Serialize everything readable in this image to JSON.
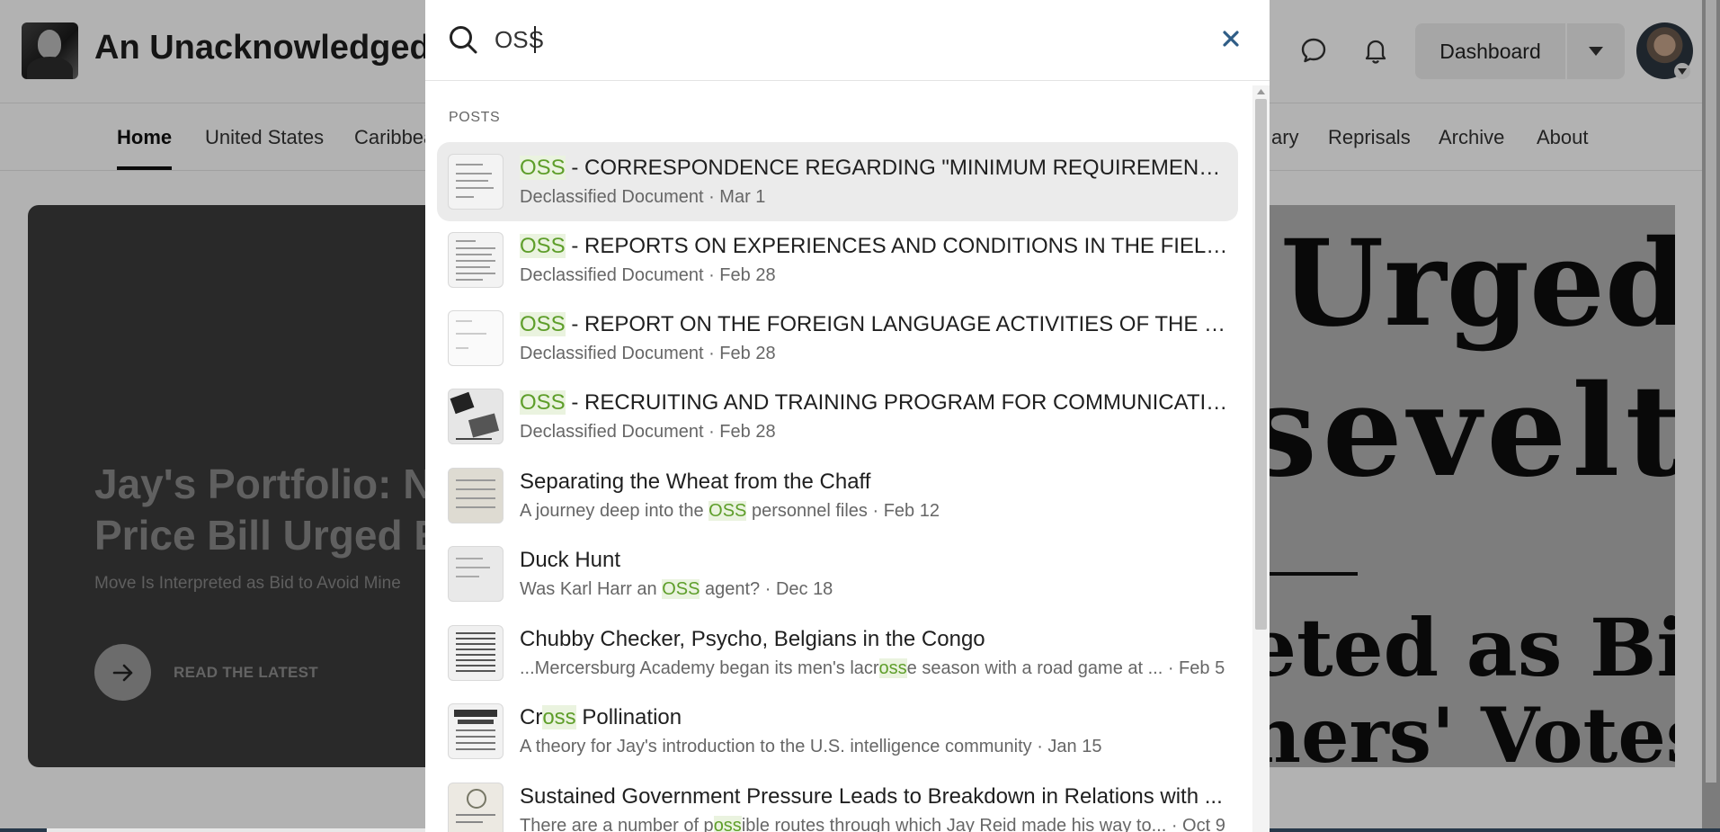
{
  "site": {
    "title": "An Unacknowledged",
    "nav": [
      "Home",
      "United States",
      "Caribbea",
      "ary",
      "Reprisals",
      "Archive",
      "About"
    ],
    "dashboard_label": "Dashboard"
  },
  "hero": {
    "title_line1": "Jay's Portfolio: N",
    "title_line2": "Price Bill Urged E",
    "subtitle": "Move Is Interpreted as Bid to Avoid Mine",
    "cta": "READ THE LATEST",
    "clipping": {
      "line1": "Urged",
      "line2": "sevelt",
      "line3": "eted as Bid",
      "line4": "ners' Votes"
    }
  },
  "search": {
    "query": "OSS",
    "section_label": "POSTS",
    "results": [
      {
        "title_hl": "OSS",
        "title_rest": " - CORRESPONDENCE REGARDING \"MINIMUM REQUIREMENTS\" F...",
        "meta": "Declassified Document · Mar 1"
      },
      {
        "title_hl": "OSS",
        "title_rest": " - REPORTS ON EXPERIENCES AND CONDITIONS IN THE FIELD/LIST...",
        "meta": "Declassified Document · Feb 28"
      },
      {
        "title_hl": "OSS",
        "title_rest": " - REPORT ON THE FOREIGN LANGUAGE ACTIVITIES OF THE NEW Y...",
        "meta": "Declassified Document · Feb 28"
      },
      {
        "title_hl": "OSS",
        "title_rest": " - RECRUITING AND TRAINING PROGRAM FOR COMMUNICATIONS...",
        "meta": "Declassified Document · Feb 28"
      },
      {
        "title": "Separating the Wheat from the Chaff",
        "meta_pre": "A journey deep into the ",
        "meta_hl": "OSS",
        "meta_post": " personnel files · Feb 12"
      },
      {
        "title": "Duck Hunt",
        "meta_pre": "Was Karl Harr an ",
        "meta_hl": "OSS",
        "meta_post": " agent? · Dec 18"
      },
      {
        "title": "Chubby Checker, Psycho, Belgians in the Congo",
        "meta_pre": "...Mercersburg Academy began its men's lacr",
        "meta_hl": "oss",
        "meta_post": "e season with a road game at ...  · Feb 5"
      },
      {
        "title_pre": "Cr",
        "title_hl": "oss",
        "title_post": " Pollination",
        "meta": "A theory for Jay's introduction to the U.S. intelligence community · Jan 15"
      },
      {
        "title": "Sustained Government Pressure Leads to Breakdown in Relations with ...",
        "meta_pre": "There are a number of p",
        "meta_hl": "oss",
        "meta_post": "ible routes through which Jay Reid made his way to... · Oct 9"
      }
    ]
  }
}
